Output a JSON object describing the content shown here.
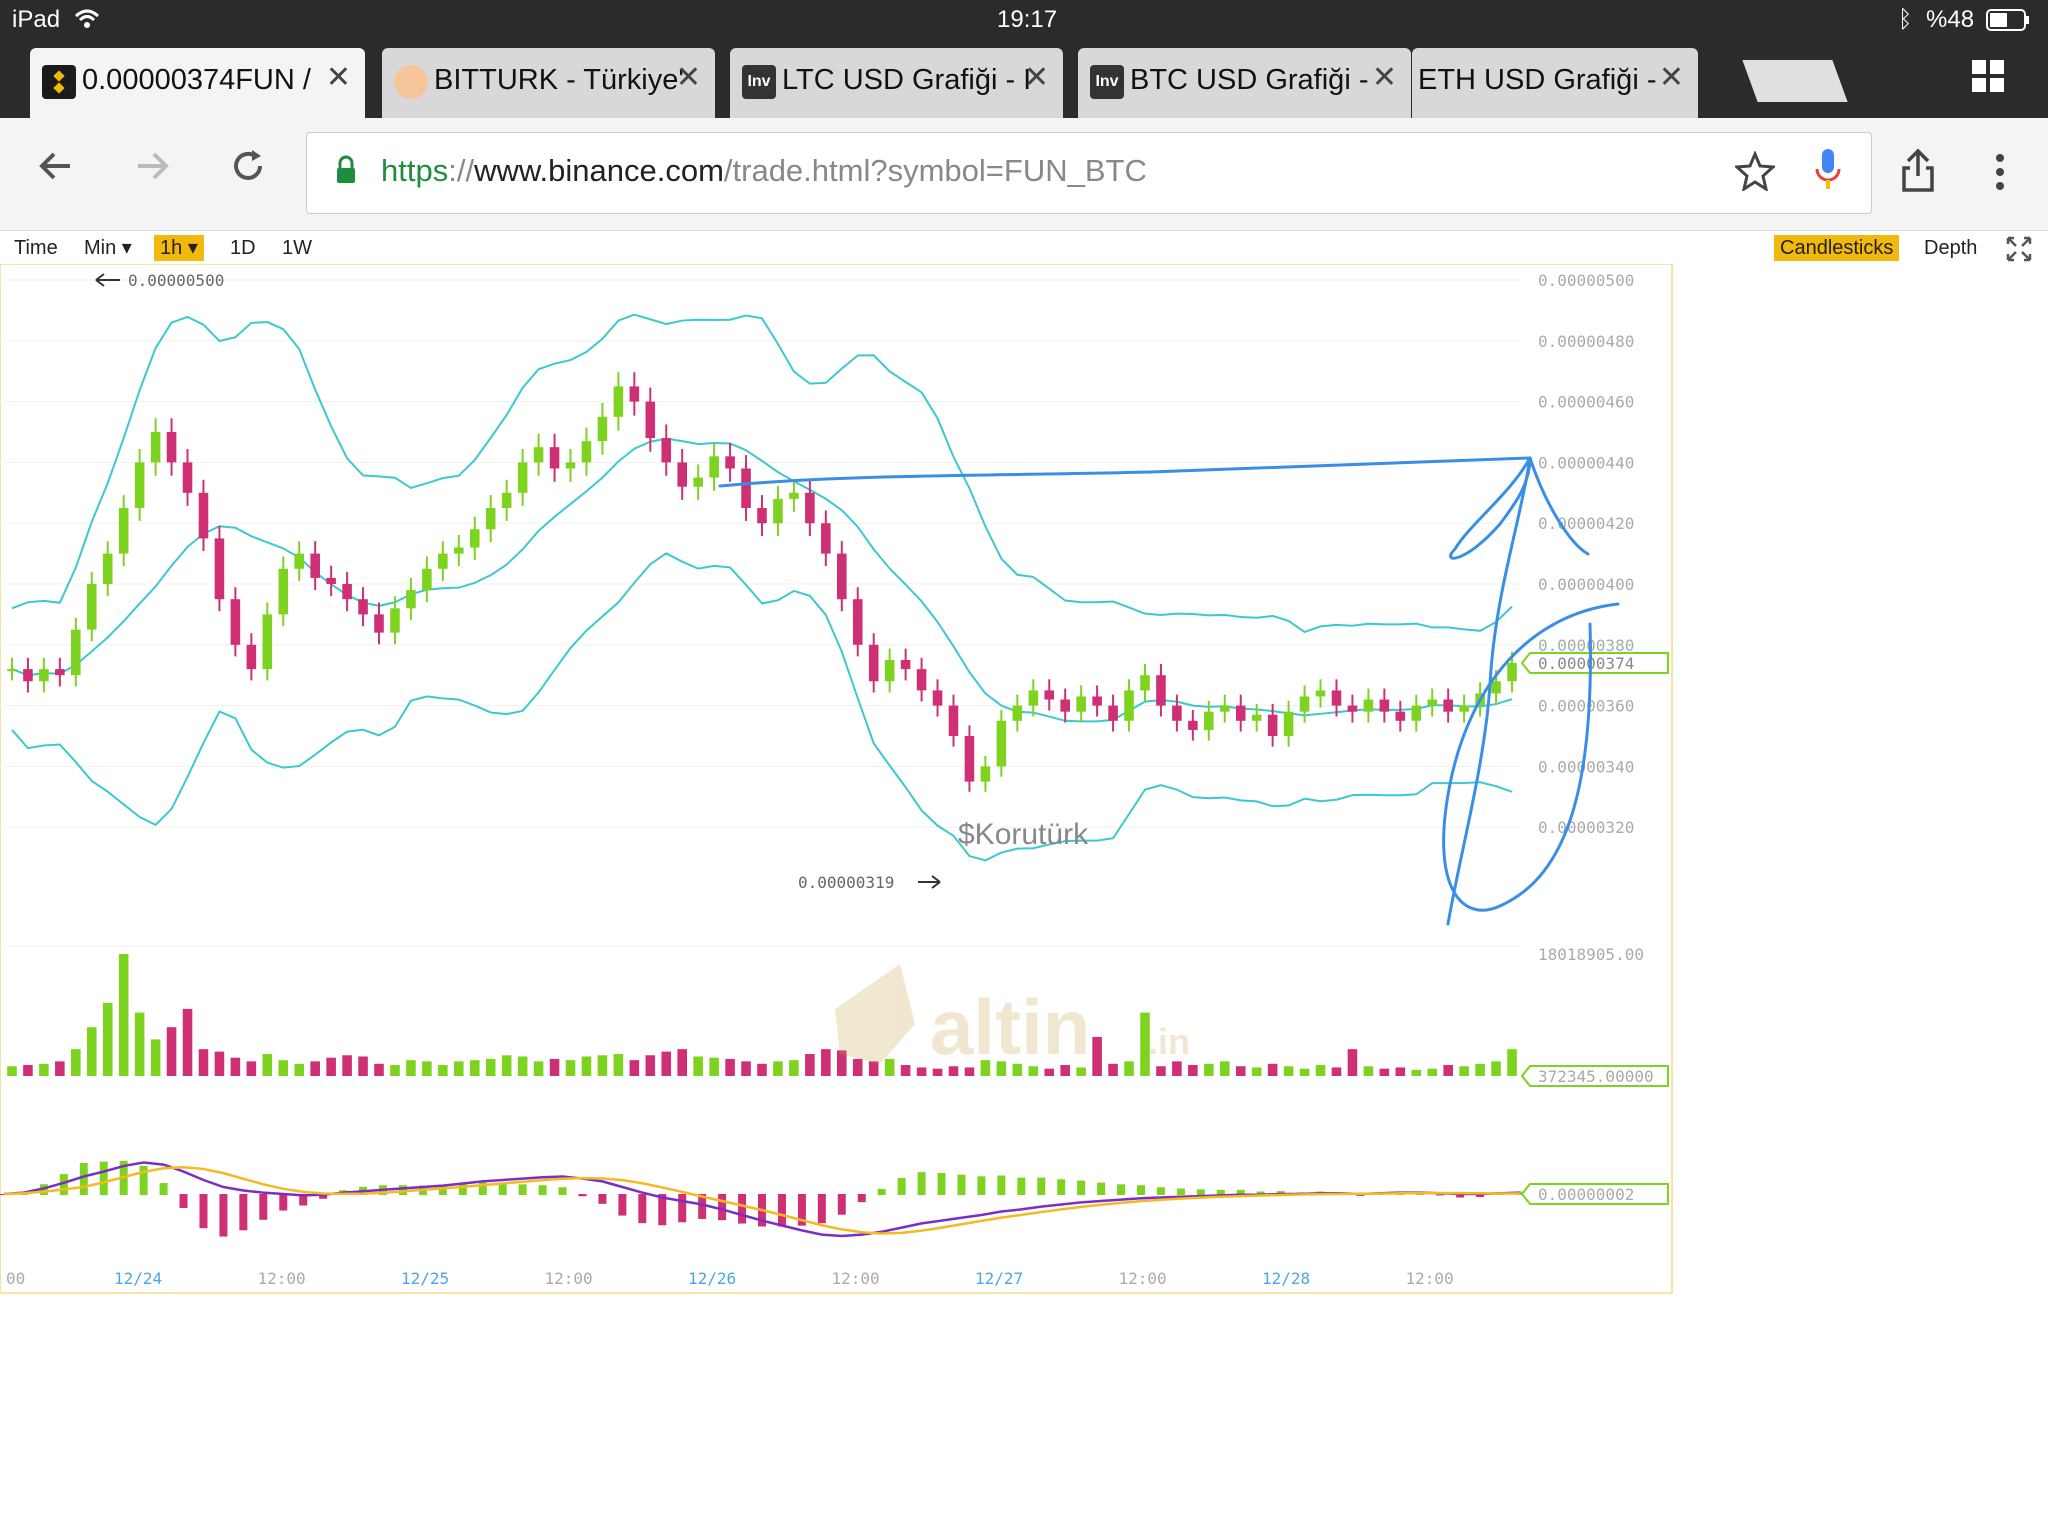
{
  "status_bar": {
    "device": "iPad",
    "time": "19:17",
    "battery": "%48"
  },
  "tabs": [
    {
      "title": "0.00000374FUN /",
      "active": true
    },
    {
      "title": "BITTURK - Türkiye'"
    },
    {
      "title": "LTC USD Grafiği - I"
    },
    {
      "title": "BTC USD Grafiği -"
    },
    {
      "title": "ETH USD Grafiği -"
    }
  ],
  "url": {
    "scheme": "https",
    "sep": "://",
    "host": "www.binance.com",
    "path": "/trade.html?symbol=FUN_BTC"
  },
  "chart_toolbar": {
    "time_label": "Time",
    "min_label": "Min",
    "interval_1h": "1h",
    "interval_1d": "1D",
    "interval_1w": "1W",
    "candlesticks_label": "Candlesticks",
    "depth_label": "Depth"
  },
  "chart_data": {
    "type": "candlestick",
    "price_axis_labels": [
      "0.00000500",
      "0.00000480",
      "0.00000460",
      "0.00000440",
      "0.00000420",
      "0.00000400",
      "0.00000380",
      "0.00000360",
      "0.00000340",
      "0.00000320"
    ],
    "price_ylim": [
      3.1e-06,
      5e-06
    ],
    "current_price": "0.00000374",
    "high_label": "0.00000500",
    "low_label": "0.00000319",
    "volume_max_label": "18018905.00",
    "volume_current_label": "372345.00000",
    "macd_current_label": "0.00000002",
    "x_ticks": [
      "00",
      "12/24",
      "12:00",
      "12/25",
      "12:00",
      "12/26",
      "12:00",
      "12/27",
      "12:00",
      "12/28",
      "12:00"
    ],
    "watermark": "$Korutürk",
    "colors": {
      "up": "#7ed321",
      "down": "#cf2f74",
      "bands": "#3cc8d0",
      "macd": "#7a2fc4",
      "signal": "#f5b921",
      "annotation": "#3a8ee6"
    },
    "up_down_markers": "green = up, magenta = down",
    "close_series": [
      3.72e-06,
      3.68e-06,
      3.72e-06,
      3.7e-06,
      3.85e-06,
      4e-06,
      4.1e-06,
      4.25e-06,
      4.4e-06,
      4.5e-06,
      4.4e-06,
      4.3e-06,
      4.15e-06,
      3.95e-06,
      3.8e-06,
      3.72e-06,
      3.9e-06,
      4.05e-06,
      4.1e-06,
      4.02e-06,
      4e-06,
      3.95e-06,
      3.9e-06,
      3.84e-06,
      3.92e-06,
      3.98e-06,
      4.05e-06,
      4.1e-06,
      4.12e-06,
      4.18e-06,
      4.25e-06,
      4.3e-06,
      4.4e-06,
      4.45e-06,
      4.38e-06,
      4.4e-06,
      4.47e-06,
      4.55e-06,
      4.65e-06,
      4.6e-06,
      4.48e-06,
      4.4e-06,
      4.32e-06,
      4.35e-06,
      4.42e-06,
      4.38e-06,
      4.25e-06,
      4.2e-06,
      4.28e-06,
      4.3e-06,
      4.2e-06,
      4.1e-06,
      3.95e-06,
      3.8e-06,
      3.68e-06,
      3.75e-06,
      3.72e-06,
      3.65e-06,
      3.6e-06,
      3.5e-06,
      3.35e-06,
      3.4e-06,
      3.55e-06,
      3.6e-06,
      3.65e-06,
      3.62e-06,
      3.58e-06,
      3.63e-06,
      3.6e-06,
      3.55e-06,
      3.65e-06,
      3.7e-06,
      3.6e-06,
      3.55e-06,
      3.52e-06,
      3.58e-06,
      3.6e-06,
      3.55e-06,
      3.57e-06,
      3.5e-06,
      3.58e-06,
      3.63e-06,
      3.65e-06,
      3.6e-06,
      3.58e-06,
      3.62e-06,
      3.58e-06,
      3.55e-06,
      3.6e-06,
      3.62e-06,
      3.58e-06,
      3.6e-06,
      3.64e-06,
      3.68e-06,
      3.74e-06
    ],
    "volume_series": [
      0.08,
      0.09,
      0.1,
      0.12,
      0.22,
      0.4,
      0.6,
      1.0,
      0.52,
      0.3,
      0.4,
      0.55,
      0.22,
      0.2,
      0.15,
      0.12,
      0.18,
      0.13,
      0.1,
      0.12,
      0.15,
      0.17,
      0.16,
      0.1,
      0.09,
      0.13,
      0.12,
      0.09,
      0.12,
      0.13,
      0.14,
      0.17,
      0.16,
      0.12,
      0.14,
      0.13,
      0.16,
      0.17,
      0.18,
      0.13,
      0.17,
      0.2,
      0.22,
      0.16,
      0.15,
      0.14,
      0.12,
      0.1,
      0.12,
      0.13,
      0.18,
      0.22,
      0.21,
      0.14,
      0.12,
      0.14,
      0.09,
      0.07,
      0.06,
      0.08,
      0.07,
      0.13,
      0.12,
      0.1,
      0.08,
      0.06,
      0.09,
      0.07,
      0.32,
      0.1,
      0.12,
      0.52,
      0.08,
      0.12,
      0.09,
      0.1,
      0.12,
      0.08,
      0.07,
      0.1,
      0.08,
      0.06,
      0.09,
      0.07,
      0.22,
      0.08,
      0.06,
      0.07,
      0.05,
      0.06,
      0.09,
      0.08,
      0.1,
      0.12,
      0.22
    ],
    "macd_series": [
      0.0,
      0.02,
      0.08,
      0.16,
      0.25,
      0.32,
      0.4,
      0.45,
      0.42,
      0.32,
      0.2,
      0.1,
      0.05,
      0.02,
      0.0,
      -0.02,
      -0.01,
      0.02,
      0.04,
      0.06,
      0.08,
      0.1,
      0.12,
      0.15,
      0.18,
      0.2,
      0.22,
      0.24,
      0.25,
      0.22,
      0.18,
      0.1,
      0.02,
      -0.05,
      -0.1,
      -0.15,
      -0.22,
      -0.3,
      -0.38,
      -0.45,
      -0.52,
      -0.58,
      -0.6,
      -0.58,
      -0.54,
      -0.48,
      -0.42,
      -0.38,
      -0.34,
      -0.3,
      -0.25,
      -0.22,
      -0.18,
      -0.15,
      -0.12,
      -0.1,
      -0.08,
      -0.06,
      -0.05,
      -0.04,
      -0.03,
      -0.02,
      -0.01,
      -0.01,
      0.0,
      0.0,
      0.01,
      0.01,
      0.0,
      0.01,
      0.02,
      0.02,
      0.01,
      0.0,
      0.0,
      0.01,
      0.02
    ]
  }
}
